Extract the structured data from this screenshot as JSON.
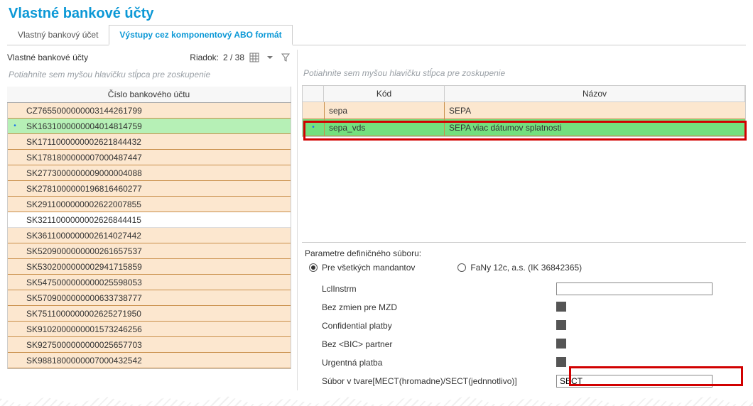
{
  "title": "Vlastné bankové účty",
  "tabs": [
    {
      "label": "Vlastný bankový účet",
      "active": false
    },
    {
      "label": "Výstupy cez komponentový ABO formát",
      "active": true
    }
  ],
  "left": {
    "panel_title": "Vlastné bankové účty",
    "row_label": "Riadok:",
    "row_counter": "2 / 38",
    "group_hint": "Potiahnite sem myšou hlavičku stĺpca pre zoskupenie",
    "columns": [
      "Číslo bankového účtu"
    ],
    "rows": [
      {
        "value": "CZ7655000000003144261799",
        "selected": false,
        "marker": ""
      },
      {
        "value": "SK1631000000004014814759",
        "selected": true,
        "marker": "•"
      },
      {
        "value": "SK1711000000002621844432",
        "selected": false,
        "marker": ""
      },
      {
        "value": "SK1781800000007000487447",
        "selected": false,
        "marker": ""
      },
      {
        "value": "SK2773000000009000004088",
        "selected": false,
        "marker": ""
      },
      {
        "value": "SK2781000000196816460277",
        "selected": false,
        "marker": ""
      },
      {
        "value": "SK2911000000002622007855",
        "selected": false,
        "marker": ""
      },
      {
        "value": "SK3211000000002626844415",
        "selected": false,
        "marker": "",
        "plain": true
      },
      {
        "value": "SK3611000000002614027442",
        "selected": false,
        "marker": ""
      },
      {
        "value": "SK5209000000000261657537",
        "selected": false,
        "marker": ""
      },
      {
        "value": "SK5302000000002941715859",
        "selected": false,
        "marker": ""
      },
      {
        "value": "SK5475000000000025598053",
        "selected": false,
        "marker": ""
      },
      {
        "value": "SK5709000000000633738777",
        "selected": false,
        "marker": ""
      },
      {
        "value": "SK7511000000002625271950",
        "selected": false,
        "marker": ""
      },
      {
        "value": "SK9102000000001573246256",
        "selected": false,
        "marker": ""
      },
      {
        "value": "SK9275000000000025657703",
        "selected": false,
        "marker": ""
      },
      {
        "value": "SK9881800000007000432542",
        "selected": false,
        "marker": ""
      }
    ]
  },
  "right": {
    "group_hint": "Potiahnite sem myšou hlavičku stĺpca pre zoskupenie",
    "columns": [
      "Kód",
      "Názov"
    ],
    "rows": [
      {
        "kod": "sepa",
        "nazov": "SEPA",
        "selected": false,
        "marker": ""
      },
      {
        "kod": "sepa_vds",
        "nazov": "SEPA viac dátumov splatnosti",
        "selected": true,
        "marker": "•"
      }
    ]
  },
  "params": {
    "title": "Parametre definičného súboru:",
    "radios": [
      {
        "label": "Pre všetkých mandantov",
        "checked": true
      },
      {
        "label": "FaNy 12c, a.s. (IK 36842365)",
        "checked": false
      }
    ],
    "fields": [
      {
        "label": "LclInstrm",
        "type": "text",
        "value": ""
      },
      {
        "label": "Bez zmien pre MZD",
        "type": "check",
        "value": true
      },
      {
        "label": "Confidential platby",
        "type": "check",
        "value": true
      },
      {
        "label": "Bez <BIC> partner",
        "type": "check",
        "value": true
      },
      {
        "label": "Urgentná platba",
        "type": "check",
        "value": true
      },
      {
        "label": "Súbor v tvare[MECT(hromadne)/SECT(jednnotlivo)]",
        "type": "text",
        "value": "SECT"
      }
    ]
  }
}
